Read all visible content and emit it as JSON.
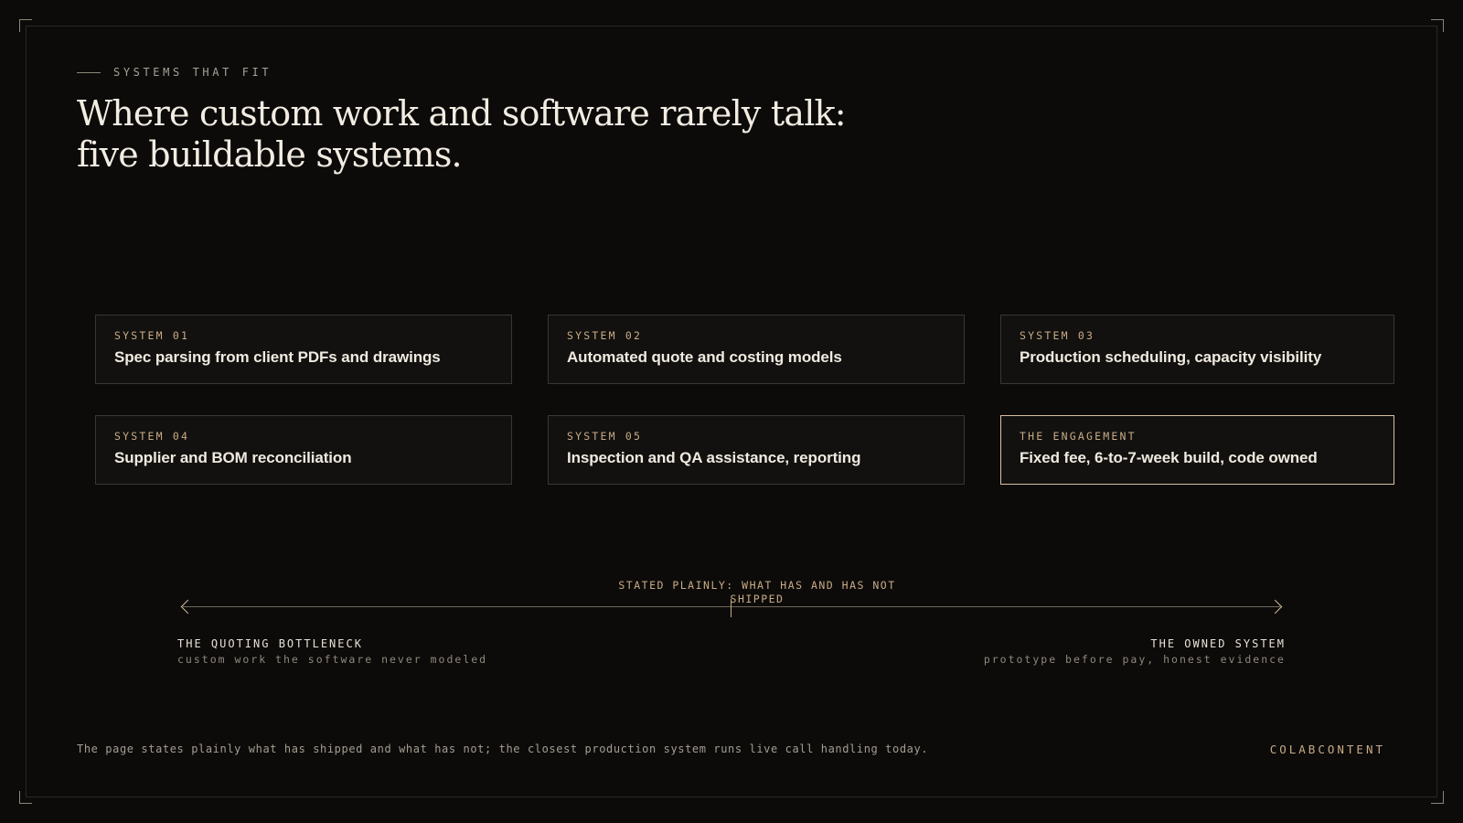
{
  "header": {
    "eyebrow": "SYSTEMS THAT FIT",
    "title": "Where custom work and software rarely talk: five buildable systems."
  },
  "cards": [
    {
      "label": "SYSTEM 01",
      "text": "Spec parsing from client PDFs and drawings"
    },
    {
      "label": "SYSTEM 02",
      "text": "Automated quote and costing models"
    },
    {
      "label": "SYSTEM 03",
      "text": "Production scheduling, capacity visibility"
    },
    {
      "label": "SYSTEM 04",
      "text": "Supplier and BOM reconciliation"
    },
    {
      "label": "SYSTEM 05",
      "text": "Inspection and QA assistance, reporting"
    },
    {
      "label": "THE ENGAGEMENT",
      "text": "Fixed fee, 6-to-7-week build, code owned"
    }
  ],
  "spectrum": {
    "center_label": "STATED PLAINLY: WHAT HAS AND HAS NOT SHIPPED",
    "left": {
      "name": "THE QUOTING BOTTLENECK",
      "sub": "custom work the software never modeled"
    },
    "right": {
      "name": "THE OWNED SYSTEM",
      "sub": "prototype before pay, honest evidence"
    }
  },
  "footer": {
    "note": "The page states plainly what has shipped and what has not; the closest production system runs live call handling today.",
    "brand": "COLABCONTENT"
  },
  "colors": {
    "background": "#0c0b0a",
    "accent": "#c9ab86",
    "highlight_border": "#d9c2a0"
  }
}
